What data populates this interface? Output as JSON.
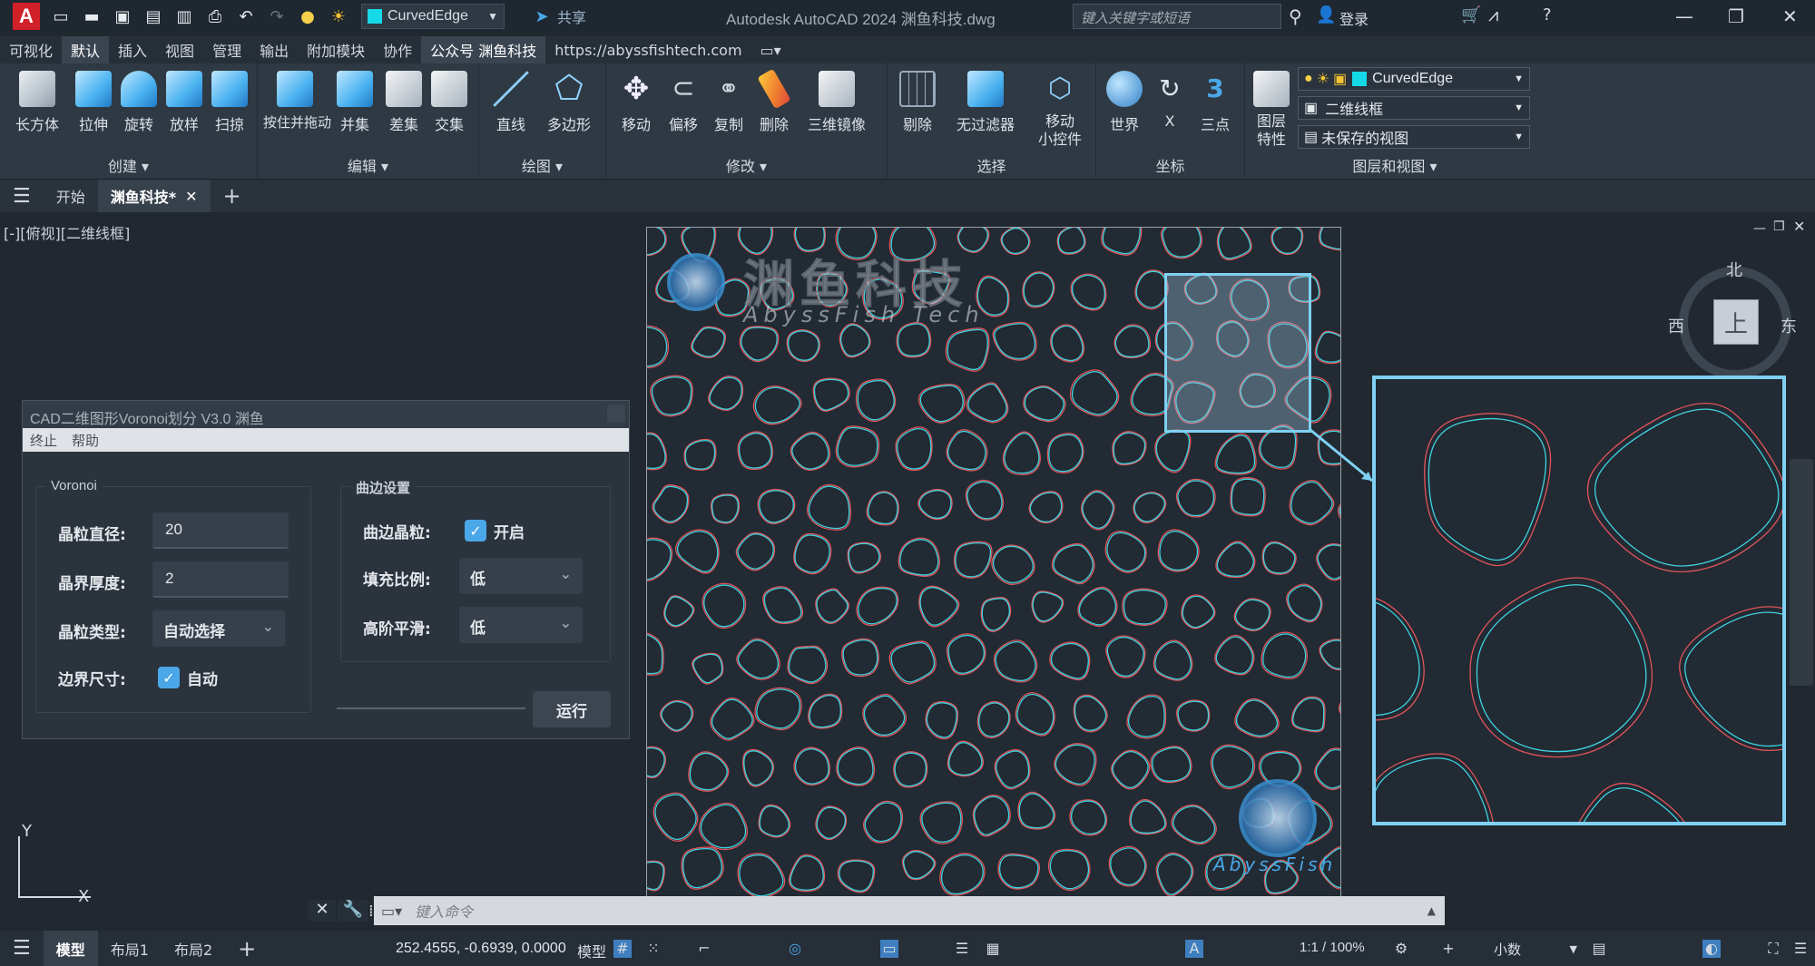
{
  "titlebar": {
    "app_logo": "A",
    "layer_name": "CurvedEdge",
    "share_label": "共享",
    "title": "Autodesk AutoCAD 2024    渊鱼科技.dwg",
    "search_placeholder": "键入关键字或短语",
    "login_label": "登录"
  },
  "menu": {
    "items": [
      "可视化",
      "默认",
      "插入",
      "视图",
      "管理",
      "输出",
      "附加模块",
      "协作",
      "公众号 渊鱼科技",
      "https://abyssfishtech.com"
    ]
  },
  "ribbon": {
    "groups": {
      "create": "创建",
      "edit": "编辑",
      "draw": "绘图",
      "modify": "修改",
      "select": "选择",
      "coords": "坐标",
      "layers": "图层和视图"
    },
    "buttons": {
      "box": "长方体",
      "extrude": "拉伸",
      "revolve": "旋转",
      "loft": "放样",
      "sweep": "扫掠",
      "presspull": "按住并拖动",
      "union": "并集",
      "subtract": "差集",
      "intersect": "交集",
      "line": "直线",
      "polygon": "多边形",
      "move": "移动",
      "offset": "偏移",
      "copy": "复制",
      "erase": "删除",
      "mirror3d": "三维镜像",
      "cull": "剔除",
      "nofilter": "无过滤器",
      "gizmo": "移动\n小控件",
      "world": "世界",
      "x": "X",
      "threepoint": "三点",
      "layerprops": "图层\n特性"
    },
    "layer_combo": "CurvedEdge",
    "visual_style": "二维线框",
    "view": "未保存的视图"
  },
  "tabs": {
    "start": "开始",
    "file": "渊鱼科技*"
  },
  "viewport": {
    "label": "[-][俯视][二维线框]",
    "compass": {
      "north": "北",
      "west": "西",
      "east": "东",
      "top": "上"
    },
    "axis_y": "Y",
    "axis_x": "X"
  },
  "dialog": {
    "title": "CAD二维图形Voronoi划分 V3.0 渊鱼",
    "menu": [
      "终止",
      "帮助"
    ],
    "voronoi_legend": "Voronoi",
    "curved_legend": "曲边设置",
    "grain_diameter_label": "晶粒直径:",
    "grain_diameter_value": "20",
    "boundary_thickness_label": "晶界厚度:",
    "boundary_thickness_value": "2",
    "grain_type_label": "晶粒类型:",
    "grain_type_value": "自动选择",
    "border_size_label": "边界尺寸:",
    "border_size_value": "自动",
    "curved_grain_label": "曲边晶粒:",
    "curved_grain_value": "开启",
    "fill_ratio_label": "填充比例:",
    "fill_ratio_value": "低",
    "smoothing_label": "高阶平滑:",
    "smoothing_value": "低",
    "run_label": "运行"
  },
  "watermark": {
    "brand_cn": "渊鱼科技",
    "brand_en": "AbyssFish Tech",
    "brand_small": "AbyssFish"
  },
  "cmdline": {
    "placeholder": "键入命令"
  },
  "statusbar": {
    "tabs": [
      "模型",
      "布局1",
      "布局2"
    ],
    "coords": "252.4555, -0.6939, 0.0000",
    "model_label": "模型",
    "scale": "1:1 / 100%",
    "units": "小数"
  },
  "colors": {
    "accent_cyan": "#16d9e8",
    "red_curve": "#e0545a",
    "cyan_curve": "#3fd3e0",
    "zoom_border": "#7fd0f3"
  }
}
